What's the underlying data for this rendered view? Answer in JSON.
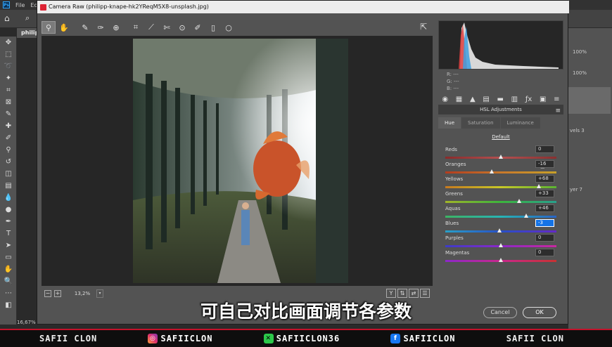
{
  "ps": {
    "menu": [
      "File",
      "Edi"
    ],
    "tab_label": "philip",
    "zoom_status": "16,67%",
    "right_panel": {
      "zoom_a": "100%",
      "zoom_b": "100%",
      "layer_label_1": "vels 3",
      "layer_label_2": "yer 7"
    }
  },
  "dialog": {
    "title": "Camera Raw (philipp-knape-hk2YReqM5X8-unsplash.jpg)",
    "zoom_value": "13,2%",
    "readout": {
      "r": "R:",
      "g": "G:",
      "b": "B:",
      "dash": "---"
    },
    "panel_header": "HSL Adjustments",
    "hsl_tabs": [
      "Hue",
      "Saturation",
      "Luminance"
    ],
    "default_label": "Default",
    "sliders": [
      {
        "label": "Reds",
        "value": "0",
        "pos": 0.0,
        "colors": [
          "#8a2a2a",
          "#b45050",
          "#8a3030"
        ]
      },
      {
        "label": "Oranges",
        "value": "-16",
        "pos": -16,
        "colors": [
          "#b43c1e",
          "#c8782a",
          "#c8a028"
        ]
      },
      {
        "label": "Yellows",
        "value": "+68",
        "pos": 68,
        "colors": [
          "#c87a1e",
          "#c8c828",
          "#5ab432"
        ]
      },
      {
        "label": "Greens",
        "value": "+33",
        "pos": 33,
        "colors": [
          "#a0b428",
          "#3cb43c",
          "#28a08c"
        ]
      },
      {
        "label": "Aquas",
        "value": "+46",
        "pos": 46,
        "colors": [
          "#3cb464",
          "#28b4b4",
          "#2864c8"
        ]
      },
      {
        "label": "Blues",
        "value": "-3",
        "pos": -3,
        "colors": [
          "#28a0c8",
          "#2850c8",
          "#6428c8"
        ]
      },
      {
        "label": "Purples",
        "value": "0",
        "pos": 0,
        "colors": [
          "#3c3cc8",
          "#8c28c8",
          "#c828a0"
        ]
      },
      {
        "label": "Magentas",
        "value": "0",
        "pos": 0,
        "colors": [
          "#8c28c8",
          "#c8288c",
          "#c83232"
        ]
      }
    ],
    "selected_slider": "Blues",
    "cancel_label": "Cancel",
    "ok_label": "OK"
  },
  "subtitle": "可自己对比画面调节各参数",
  "banner": {
    "brand_left": "SAFII CLON",
    "brand_right": "SAFII CLON",
    "socials": [
      {
        "icon": "instagram-icon",
        "handle": "SAFIICLON"
      },
      {
        "icon": "x-icon",
        "handle": "SAFIICLON36"
      },
      {
        "icon": "facebook-icon",
        "handle": "SAFIICLON"
      }
    ]
  },
  "colors": {
    "accent_blue": "#1473e6",
    "banner_red": "#c4122a"
  }
}
